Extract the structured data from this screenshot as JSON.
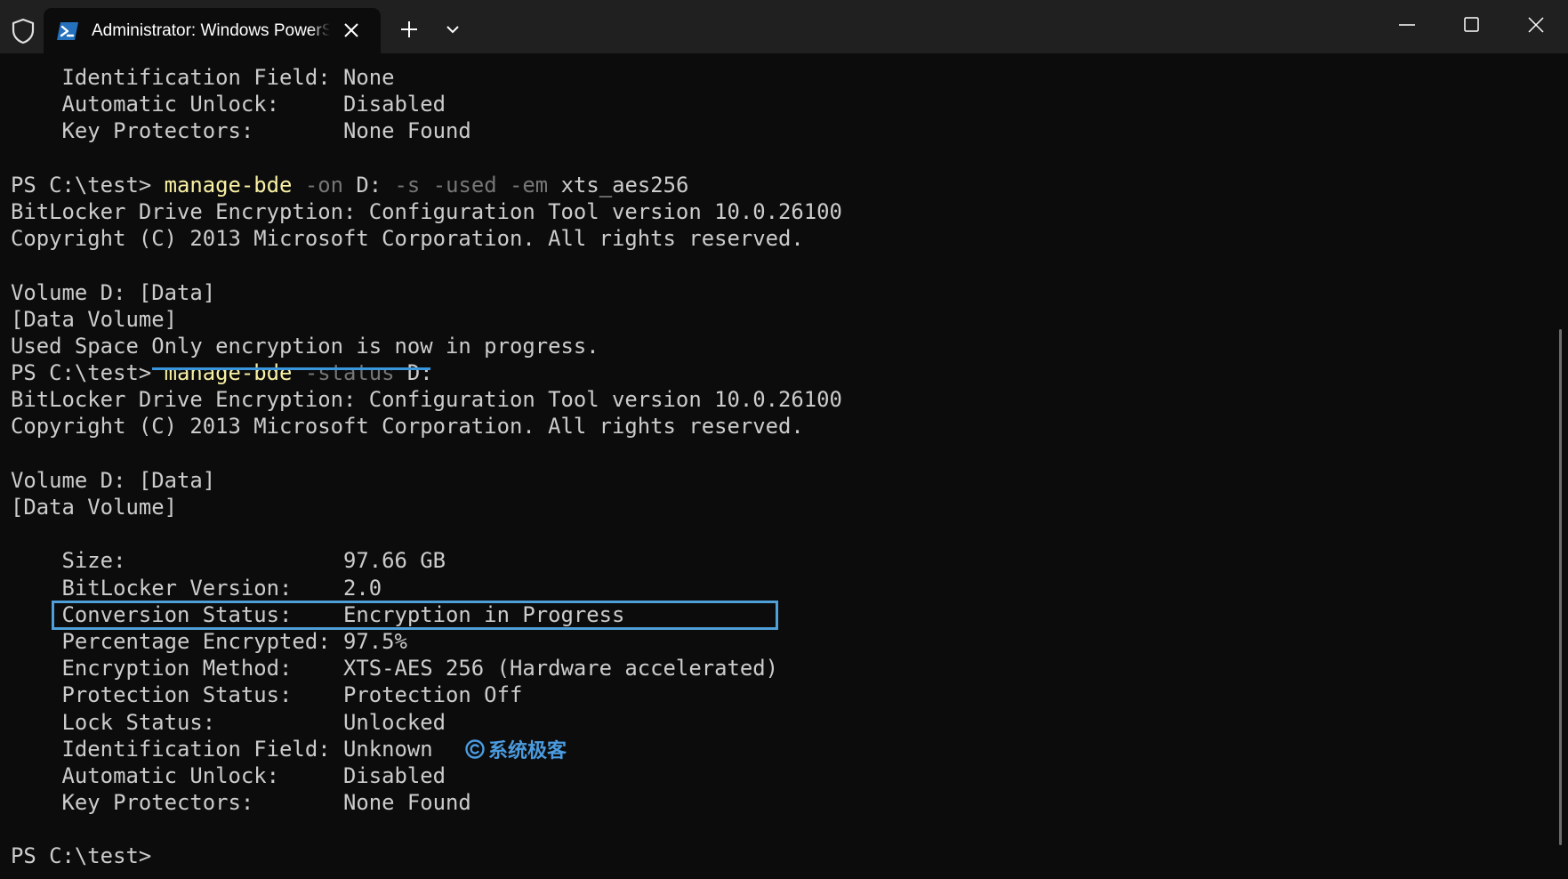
{
  "window": {
    "tab_title": "Administrator: Windows PowerShell",
    "shield_icon": "shield-icon",
    "tab_icon": "powershell-icon",
    "close_tab_icon": "close-icon",
    "new_tab_icon": "plus-icon",
    "dropdown_icon": "chevron-down-icon",
    "minimize_icon": "minimize-icon",
    "maximize_icon": "maximize-icon",
    "close_window_icon": "close-icon"
  },
  "colors": {
    "background": "#0c0c0c",
    "titlebar": "#202020",
    "text": "#cccccc",
    "command": "#f9f1a5",
    "parameter": "#767676",
    "highlight": "#4f9fd8"
  },
  "terminal": {
    "lines": [
      "    Identification Field: None",
      "    Automatic Unlock:     Disabled",
      "    Key Protectors:       None Found",
      "",
      "PS C:\\test> manage-bde -on D: -s -used -em xts_aes256",
      "BitLocker Drive Encryption: Configuration Tool version 10.0.26100",
      "Copyright (C) 2013 Microsoft Corporation. All rights reserved.",
      "",
      "Volume D: [Data]",
      "[Data Volume]",
      "Used Space Only encryption is now in progress.",
      "PS C:\\test> manage-bde -status D:",
      "BitLocker Drive Encryption: Configuration Tool version 10.0.26100",
      "Copyright (C) 2013 Microsoft Corporation. All rights reserved.",
      "",
      "Volume D: [Data]",
      "[Data Volume]",
      "",
      "    Size:                 97.66 GB",
      "    BitLocker Version:    2.0",
      "    Conversion Status:    Encryption in Progress",
      "    Percentage Encrypted: 97.5%",
      "    Encryption Method:    XTS-AES 256 (Hardware accelerated)",
      "    Protection Status:    Protection Off",
      "    Lock Status:          Unlocked",
      "    Identification Field: Unknown",
      "    Automatic Unlock:     Disabled",
      "    Key Protectors:       None Found",
      "",
      "PS C:\\test>"
    ],
    "command_lines": {
      "4": {
        "prompt": "PS C:\\test> ",
        "segments": [
          [
            "cmd",
            "manage-bde"
          ],
          [
            "text",
            " "
          ],
          [
            "param",
            "-on"
          ],
          [
            "text",
            " D: "
          ],
          [
            "param",
            "-s"
          ],
          [
            "text",
            " "
          ],
          [
            "param",
            "-used"
          ],
          [
            "text",
            " "
          ],
          [
            "param",
            "-em"
          ],
          [
            "text",
            " xts_aes256"
          ]
        ]
      },
      "11": {
        "prompt": "PS C:\\test> ",
        "segments": [
          [
            "cmd",
            "manage-bde"
          ],
          [
            "text",
            " "
          ],
          [
            "param",
            "-status"
          ],
          [
            "text",
            " D:"
          ]
        ]
      }
    },
    "highlighted_line_index": 22,
    "underlined_line_index": 11
  },
  "watermark": {
    "text": "系统极客",
    "logo_icon": "copyright-circle-icon"
  }
}
